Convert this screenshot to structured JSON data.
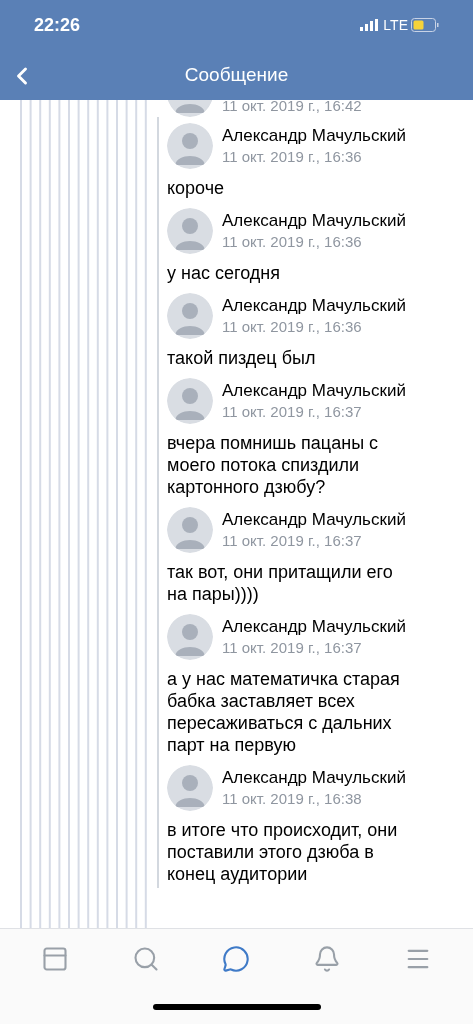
{
  "status_bar": {
    "time": "22:26",
    "network": "LTE"
  },
  "nav": {
    "title": "Сообщение"
  },
  "messages": [
    {
      "kind": "partial",
      "time": "11 окт. 2019 г., 16:42"
    },
    {
      "kind": "full",
      "author": "Александр Мачульский",
      "time": "11 окт. 2019 г., 16:36",
      "text": "короче"
    },
    {
      "kind": "full",
      "author": "Александр Мачульский",
      "time": "11 окт. 2019 г., 16:36",
      "text": "у нас сегодня"
    },
    {
      "kind": "full",
      "author": "Александр Мачульский",
      "time": "11 окт. 2019 г., 16:36",
      "text": "такой пиздец был"
    },
    {
      "kind": "full",
      "author": "Александр Мачульский",
      "time": "11 окт. 2019 г., 16:37",
      "text": "вчера помнишь пацаны с моего потока спиздили картонного дзюбу?"
    },
    {
      "kind": "full",
      "author": "Александр Мачульский",
      "time": "11 окт. 2019 г., 16:37",
      "text": "так вот, они притащили его на пары))))"
    },
    {
      "kind": "full",
      "author": "Александр Мачульский",
      "time": "11 окт. 2019 г., 16:37",
      "text": "а у нас математичка старая бабка заставляет всех пересаживаться с дальних парт на первую"
    },
    {
      "kind": "full",
      "author": "Александр Мачульский",
      "time": "11 окт. 2019 г., 16:38",
      "text": "в итоге что происходит, они поставили этого дзюба в конец аудитории"
    }
  ],
  "tab_bar": [
    {
      "selected": false
    },
    {
      "selected": false
    },
    {
      "selected": true
    },
    {
      "selected": false
    },
    {
      "selected": false
    }
  ]
}
